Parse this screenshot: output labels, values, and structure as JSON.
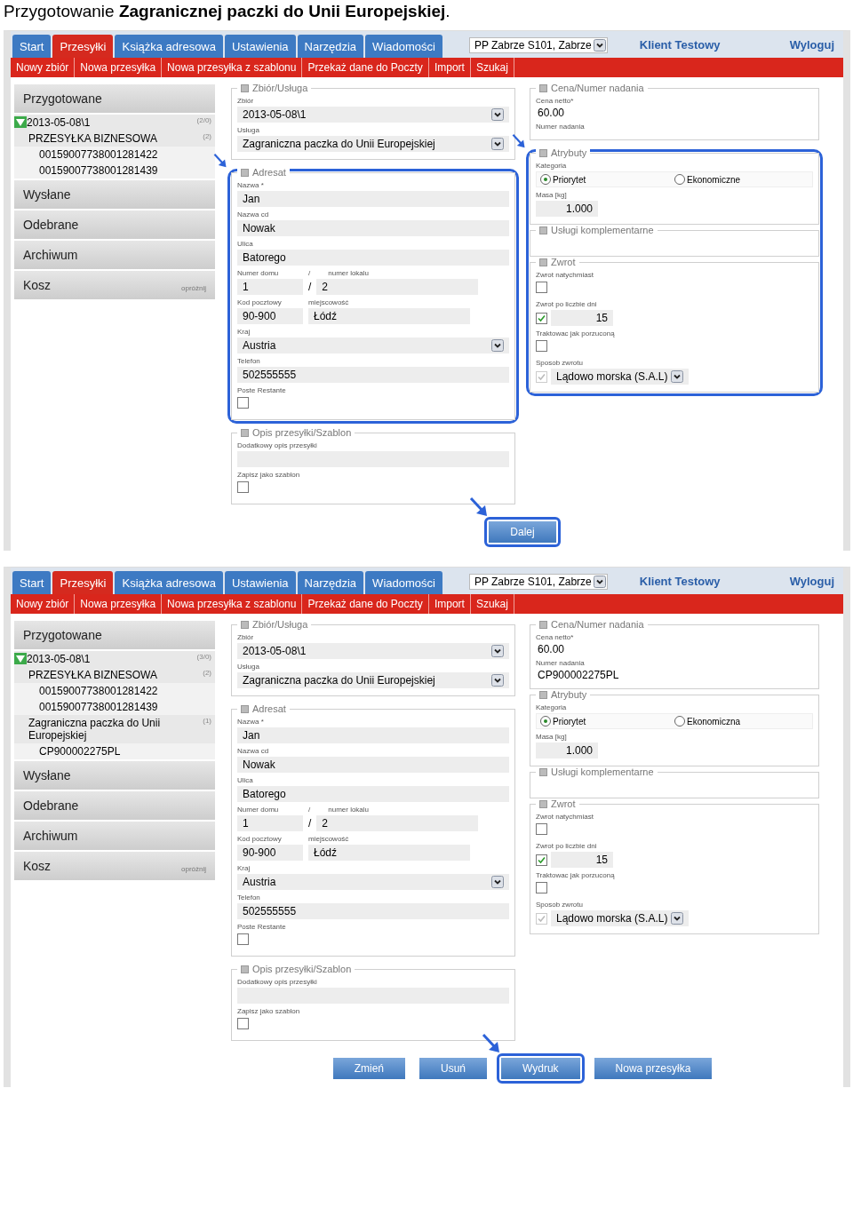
{
  "caption": "Przygotowanie **Zagranicznej paczki do Unii Europejskiej**.",
  "screens": [
    {
      "tabs": [
        {
          "label": "Start",
          "selected": false
        },
        {
          "label": "Przesyłki",
          "selected": true
        },
        {
          "label": "Książka adresowa",
          "selected": false
        },
        {
          "label": "Ustawienia",
          "selected": false
        },
        {
          "label": "Narzędzia",
          "selected": false
        },
        {
          "label": "Wiadomości",
          "selected": false
        }
      ],
      "location": "PP Zabrze S101, Zabrze",
      "user": "Klient Testowy",
      "logout": "Wyloguj",
      "subnav": [
        "Nowy zbiór",
        "Nowa przesyłka",
        "Nowa przesyłka z szablonu",
        "Przekaż dane do Poczty",
        "Import",
        "Szukaj"
      ],
      "sidebar": [
        {
          "label": "Przygotowane",
          "children": [
            {
              "label": "2013-05-08\\1",
              "count": "(2/0)",
              "expanded": true,
              "children": [
                {
                  "label": "PRZESYŁKA BIZNESOWA",
                  "count": "(2)",
                  "children": [
                    {
                      "label": "00159007738001281422"
                    },
                    {
                      "label": "00159007738001281439"
                    }
                  ]
                }
              ]
            }
          ]
        },
        {
          "label": "Wysłane"
        },
        {
          "label": "Odebrane"
        },
        {
          "label": "Archiwum"
        },
        {
          "label": "Kosz",
          "action": "opróżnij"
        }
      ],
      "main": [
        {
          "highlighted": false,
          "arrow": false,
          "groups": [
            {
              "title": "Zbiór/Usługa",
              "fields": [
                {
                  "kind": "select",
                  "label": "Zbiór",
                  "value": "2013-05-08\\1"
                },
                {
                  "kind": "select",
                  "label": "Usługa",
                  "value": "Zagraniczna paczka do Unii Europejskiej"
                }
              ]
            }
          ]
        },
        {
          "highlighted": true,
          "arrow": true,
          "groups": [
            {
              "title": "Adresat",
              "fields": [
                {
                  "kind": "text",
                  "label": "Nazwa *",
                  "value": "Jan"
                },
                {
                  "kind": "text",
                  "label": "Nazwa cd",
                  "value": "Nowak"
                },
                {
                  "kind": "text",
                  "label": "Ulica",
                  "value": "Batorego"
                },
                {
                  "kind": "row",
                  "items": [
                    {
                      "label": "Numer domu",
                      "value": "1"
                    },
                    {
                      "label_prefix": "/",
                      "label": "numer lokalu",
                      "value_prefix": "/",
                      "value": "2"
                    }
                  ]
                },
                {
                  "kind": "row",
                  "items": [
                    {
                      "label": "Kod pocztowy",
                      "value": "90-900"
                    },
                    {
                      "label": "miejscowość",
                      "value": "Łódź"
                    }
                  ]
                },
                {
                  "kind": "select",
                  "label": "Kraj",
                  "value": "Austria"
                },
                {
                  "kind": "text",
                  "label": "Telefon",
                  "value": "502555555"
                },
                {
                  "kind": "checkbox",
                  "label": "Poste Restante",
                  "checked": false
                }
              ]
            }
          ]
        },
        {
          "highlighted": false,
          "arrow": false,
          "groups": [
            {
              "title": "Opis przesyłki/Szablon",
              "fields": [
                {
                  "kind": "text",
                  "label": "Dodatkowy opis przesyłki"
                },
                {
                  "kind": "checkbox",
                  "label": "Zapisz jako szablon",
                  "checked": false
                }
              ]
            }
          ]
        }
      ],
      "side": [
        {
          "highlighted": false,
          "arrow": false,
          "groups": [
            {
              "title": "Cena/Numer nadania",
              "fields": [
                {
                  "kind": "static",
                  "label": "Cena netto*",
                  "value": "60.00"
                },
                {
                  "kind": "static",
                  "label": "Numer nadania"
                }
              ]
            }
          ]
        },
        {
          "highlighted": true,
          "arrow": true,
          "groups": [
            {
              "title": "Atrybuty",
              "fields": [
                {
                  "kind": "radio",
                  "label": "Kategoria",
                  "options": [
                    {
                      "label": "Priorytet",
                      "selected": true
                    },
                    {
                      "label": "Ekonomiczne",
                      "selected": false
                    }
                  ]
                },
                {
                  "kind": "number",
                  "label": "Masa [kg]",
                  "value": "1.000"
                }
              ]
            },
            {
              "title": "Usługi komplementarne"
            },
            {
              "title": "Zwrot",
              "fields": [
                {
                  "kind": "checkbox",
                  "label": "Zwrot natychmiast",
                  "checked": false
                },
                {
                  "kind": "checkbox_number",
                  "label": "Zwrot po liczbie dni",
                  "checked": true,
                  "value": "15"
                },
                {
                  "kind": "checkbox",
                  "label": "Traktowac jak porzuconą",
                  "checked": false
                },
                {
                  "kind": "checkbox_select",
                  "label": "Sposob zwrotu",
                  "checked": true,
                  "disabled": true,
                  "value": "Lądowo morska (S.A.L)"
                }
              ]
            }
          ]
        }
      ],
      "buttons": [
        {
          "label": "Dalej",
          "highlighted": true,
          "arrow": true
        }
      ]
    },
    {
      "tabs": [
        {
          "label": "Start",
          "selected": false
        },
        {
          "label": "Przesyłki",
          "selected": true
        },
        {
          "label": "Książka adresowa",
          "selected": false
        },
        {
          "label": "Ustawienia",
          "selected": false
        },
        {
          "label": "Narzędzia",
          "selected": false
        },
        {
          "label": "Wiadomości",
          "selected": false
        }
      ],
      "location": "PP Zabrze S101, Zabrze",
      "user": "Klient Testowy",
      "logout": "Wyloguj",
      "subnav": [
        "Nowy zbiór",
        "Nowa przesyłka",
        "Nowa przesyłka z szablonu",
        "Przekaż dane do Poczty",
        "Import",
        "Szukaj"
      ],
      "sidebar": [
        {
          "label": "Przygotowane",
          "children": [
            {
              "label": "2013-05-08\\1",
              "count": "(3/0)",
              "expanded": true,
              "children": [
                {
                  "label": "PRZESYŁKA BIZNESOWA",
                  "count": "(2)",
                  "children": [
                    {
                      "label": "00159007738001281422"
                    },
                    {
                      "label": "00159007738001281439"
                    }
                  ]
                },
                {
                  "label": "Zagraniczna paczka do Unii Europejskiej",
                  "count": "(1)",
                  "children": [
                    {
                      "label": "CP900002275PL"
                    }
                  ]
                }
              ]
            }
          ]
        },
        {
          "label": "Wysłane"
        },
        {
          "label": "Odebrane"
        },
        {
          "label": "Archiwum"
        },
        {
          "label": "Kosz",
          "action": "opróżnij"
        }
      ],
      "main": [
        {
          "highlighted": false,
          "arrow": false,
          "groups": [
            {
              "title": "Zbiór/Usługa",
              "fields": [
                {
                  "kind": "select",
                  "label": "Zbiór",
                  "value": "2013-05-08\\1"
                },
                {
                  "kind": "select",
                  "label": "Usługa",
                  "value": "Zagraniczna paczka do Unii Europejskiej"
                }
              ]
            }
          ]
        },
        {
          "highlighted": false,
          "arrow": false,
          "groups": [
            {
              "title": "Adresat",
              "fields": [
                {
                  "kind": "text",
                  "label": "Nazwa *",
                  "value": "Jan"
                },
                {
                  "kind": "text",
                  "label": "Nazwa cd",
                  "value": "Nowak"
                },
                {
                  "kind": "text",
                  "label": "Ulica",
                  "value": "Batorego"
                },
                {
                  "kind": "row",
                  "items": [
                    {
                      "label": "Numer domu",
                      "value": "1"
                    },
                    {
                      "label_prefix": "/",
                      "label": "numer lokalu",
                      "value_prefix": "/",
                      "value": "2"
                    }
                  ]
                },
                {
                  "kind": "row",
                  "items": [
                    {
                      "label": "Kod pocztowy",
                      "value": "90-900"
                    },
                    {
                      "label": "miejscowość",
                      "value": "Łódź"
                    }
                  ]
                },
                {
                  "kind": "select",
                  "label": "Kraj",
                  "value": "Austria"
                },
                {
                  "kind": "text",
                  "label": "Telefon",
                  "value": "502555555"
                },
                {
                  "kind": "checkbox",
                  "label": "Poste Restante",
                  "checked": false
                }
              ]
            }
          ]
        },
        {
          "highlighted": false,
          "arrow": false,
          "groups": [
            {
              "title": "Opis przesyłki/Szablon",
              "fields": [
                {
                  "kind": "text",
                  "label": "Dodatkowy opis przesyłki"
                },
                {
                  "kind": "checkbox",
                  "label": "Zapisz jako szablon",
                  "checked": false
                }
              ]
            }
          ]
        }
      ],
      "side": [
        {
          "highlighted": false,
          "arrow": false,
          "groups": [
            {
              "title": "Cena/Numer nadania",
              "fields": [
                {
                  "kind": "static",
                  "label": "Cena netto*",
                  "value": "60.00"
                },
                {
                  "kind": "static",
                  "label": "Numer nadania",
                  "value": "CP900002275PL"
                }
              ]
            },
            {
              "title": "Atrybuty",
              "fields": [
                {
                  "kind": "radio",
                  "label": "Kategoria",
                  "options": [
                    {
                      "label": "Priorytet",
                      "selected": true
                    },
                    {
                      "label": "Ekonomiczna",
                      "selected": false
                    }
                  ]
                },
                {
                  "kind": "number",
                  "label": "Masa [kg]",
                  "value": "1.000"
                }
              ]
            },
            {
              "title": "Usługi komplementarne"
            },
            {
              "title": "Zwrot",
              "fields": [
                {
                  "kind": "checkbox",
                  "label": "Zwrot natychmiast",
                  "checked": false
                },
                {
                  "kind": "checkbox_number",
                  "label": "Zwrot po liczbie dni",
                  "checked": true,
                  "value": "15"
                },
                {
                  "kind": "checkbox",
                  "label": "Traktowac jak porzuconą",
                  "checked": false
                },
                {
                  "kind": "checkbox_select",
                  "label": "Sposob zwrotu",
                  "checked": true,
                  "disabled": true,
                  "value": "Lądowo morska (S.A.L)"
                }
              ]
            }
          ]
        }
      ],
      "buttons": [
        {
          "label": "Zmień",
          "highlighted": false,
          "arrow": false
        },
        {
          "label": "Usuń",
          "highlighted": false,
          "arrow": false
        },
        {
          "label": "Wydruk",
          "highlighted": true,
          "arrow": true
        },
        {
          "label": "Nowa przesyłka",
          "highlighted": false,
          "arrow": false
        }
      ]
    }
  ]
}
